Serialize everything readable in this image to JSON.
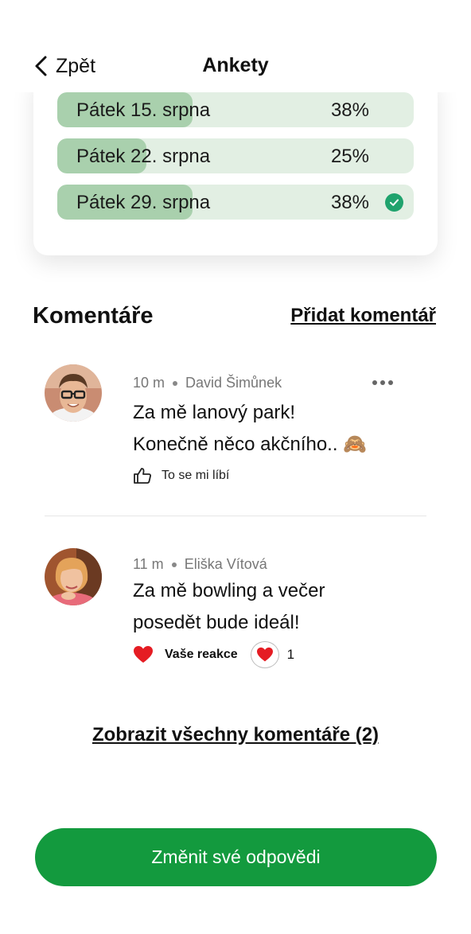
{
  "header": {
    "back_label": "Zpět",
    "title": "Ankety"
  },
  "poll": {
    "options": [
      {
        "label": "Pátek 15. srpna",
        "percent_label": "38%",
        "percent": 38,
        "selected": false
      },
      {
        "label": "Pátek 22. srpna",
        "percent_label": "25%",
        "percent": 25,
        "selected": false
      },
      {
        "label": "Pátek 29. srpna",
        "percent_label": "38%",
        "percent": 38,
        "selected": true
      }
    ]
  },
  "comments_section": {
    "title": "Komentáře",
    "add_label": "Přidat komentář",
    "comments": [
      {
        "time": "10 m",
        "author": "David Šimůnek",
        "line1": "Za mě lanový park!",
        "line2": "Konečně něco akčního.. 🙈",
        "like_label": "To se mi líbí"
      },
      {
        "time": "11 m",
        "author": "Eliška Vítová",
        "line1": "Za mě bowling a večer",
        "line2": "posedět bude ideál!",
        "reaction_label": "Vaše reakce",
        "reaction_count": "1"
      }
    ],
    "show_all_label": "Zobrazit všechny komentáře (2)"
  },
  "primary_action": {
    "label": "Změnit své odpovědi"
  },
  "colors": {
    "accent": "#139a3e",
    "option_bg": "#e2efe3",
    "option_fill": "#a9d0ad",
    "check": "#1fa36d"
  }
}
